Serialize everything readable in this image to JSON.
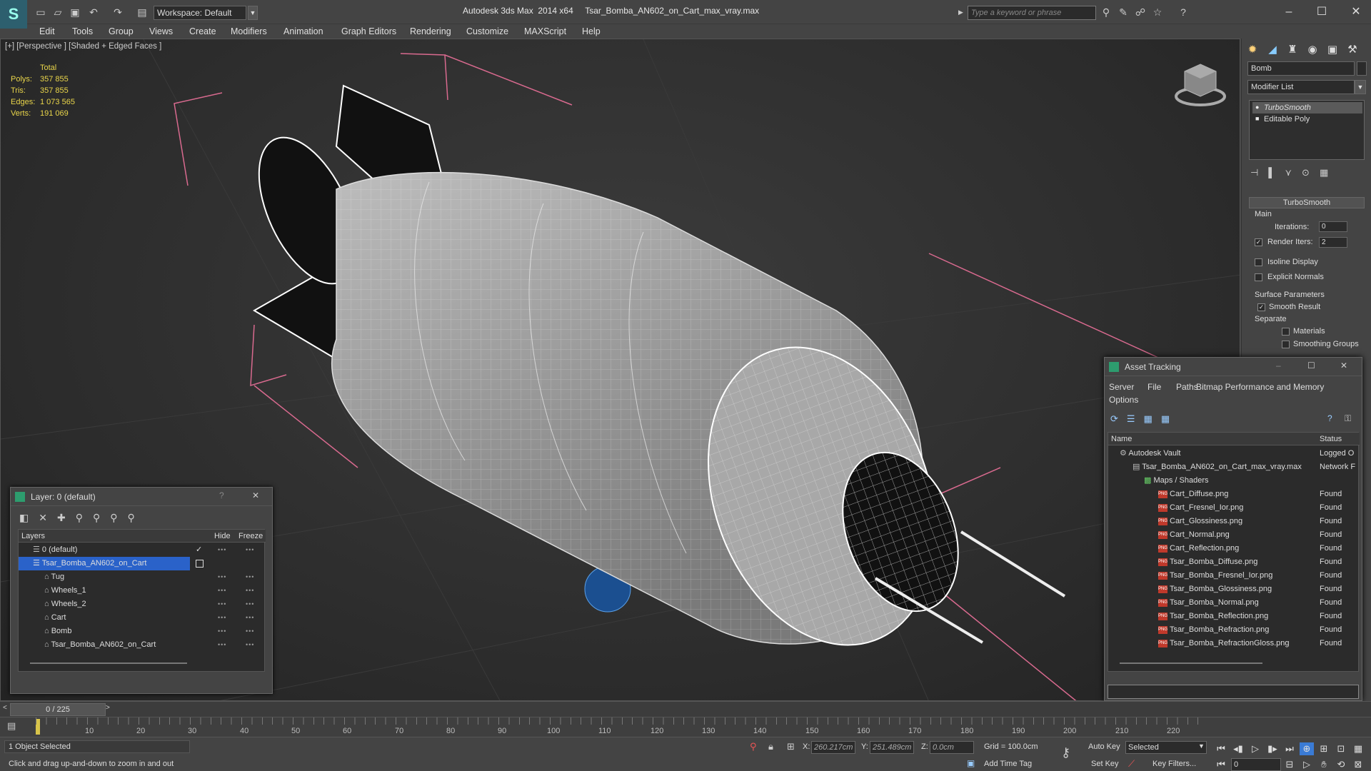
{
  "titlebar": {
    "workspace": "Workspace: Default",
    "title": "Autodesk 3ds Max  2014 x64     Tsar_Bomba_AN602_on_Cart_max_vray.max",
    "search_placeholder": "Type a keyword or phrase"
  },
  "menu": [
    "Edit",
    "Tools",
    "Group",
    "Views",
    "Create",
    "Modifiers",
    "Animation",
    "Graph Editors",
    "Rendering",
    "Customize",
    "MAXScript",
    "Help"
  ],
  "viewport": {
    "label": "[+] [Perspective ] [Shaded + Edged Faces ]",
    "stats": {
      "header": "Total",
      "rows": [
        {
          "label": "Polys:",
          "value": "357 855"
        },
        {
          "label": "Tris:",
          "value": "357 855"
        },
        {
          "label": "Edges:",
          "value": "1 073 565"
        },
        {
          "label": "Verts:",
          "value": "191 069"
        }
      ]
    }
  },
  "command_panel": {
    "object_name": "Bomb",
    "modifier_list": "Modifier List",
    "stack": [
      "TurboSmooth",
      "Editable Poly"
    ],
    "rollout_title": "TurboSmooth",
    "main_group": "Main",
    "iterations_label": "Iterations:",
    "iterations_value": "0",
    "render_iters_label": "Render Iters:",
    "render_iters_value": "2",
    "isoline_label": "Isoline Display",
    "explicit_label": "Explicit Normals",
    "surface_group": "Surface Parameters",
    "smooth_result_label": "Smooth Result",
    "separate_label": "Separate",
    "materials_label": "Materials",
    "smoothing_groups_label": "Smoothing Groups"
  },
  "layer_window": {
    "title": "Layer: 0 (default)",
    "col_layers": "Layers",
    "col_hide": "Hide",
    "col_freeze": "Freeze",
    "rows": [
      {
        "name": "0 (default)",
        "indent": 0
      },
      {
        "name": "Tsar_Bomba_AN602_on_Cart",
        "indent": 0
      },
      {
        "name": "Tug",
        "indent": 1
      },
      {
        "name": "Wheels_1",
        "indent": 1
      },
      {
        "name": "Wheels_2",
        "indent": 1
      },
      {
        "name": "Cart",
        "indent": 1
      },
      {
        "name": "Bomb",
        "indent": 1
      },
      {
        "name": "Tsar_Bomba_AN602_on_Cart",
        "indent": 1
      }
    ]
  },
  "asset_window": {
    "title": "Asset Tracking",
    "menu": [
      "Server",
      "File",
      "Paths",
      "Bitmap Performance and Memory"
    ],
    "menu2": "Options",
    "col_name": "Name",
    "col_status": "Status",
    "rows": [
      {
        "name": "Autodesk Vault",
        "status": "Logged O",
        "level": 0
      },
      {
        "name": "Tsar_Bomba_AN602_on_Cart_max_vray.max",
        "status": "Network F",
        "level": 1
      },
      {
        "name": "Maps / Shaders",
        "status": "",
        "level": 2
      },
      {
        "name": "Cart_Diffuse.png",
        "status": "Found",
        "level": 3
      },
      {
        "name": "Cart_Fresnel_Ior.png",
        "status": "Found",
        "level": 3
      },
      {
        "name": "Cart_Glossiness.png",
        "status": "Found",
        "level": 3
      },
      {
        "name": "Cart_Normal.png",
        "status": "Found",
        "level": 3
      },
      {
        "name": "Cart_Reflection.png",
        "status": "Found",
        "level": 3
      },
      {
        "name": "Tsar_Bomba_Diffuse.png",
        "status": "Found",
        "level": 3
      },
      {
        "name": "Tsar_Bomba_Fresnel_Ior.png",
        "status": "Found",
        "level": 3
      },
      {
        "name": "Tsar_Bomba_Glossiness.png",
        "status": "Found",
        "level": 3
      },
      {
        "name": "Tsar_Bomba_Normal.png",
        "status": "Found",
        "level": 3
      },
      {
        "name": "Tsar_Bomba_Reflection.png",
        "status": "Found",
        "level": 3
      },
      {
        "name": "Tsar_Bomba_Refraction.png",
        "status": "Found",
        "level": 3
      },
      {
        "name": "Tsar_Bomba_RefractionGloss.png",
        "status": "Found",
        "level": 3
      }
    ]
  },
  "timeline": {
    "frame": "0 / 225",
    "ticks": [
      "10",
      "20",
      "30",
      "40",
      "50",
      "60",
      "70",
      "80",
      "90",
      "100",
      "110",
      "120",
      "130",
      "140",
      "150",
      "160",
      "170",
      "180",
      "190",
      "200",
      "210",
      "220"
    ]
  },
  "status": {
    "selection": "1 Object Selected",
    "prompt": "Click and drag up-and-down to zoom in and out",
    "x_label": "X:",
    "x_value": "260.217cm",
    "y_label": "Y:",
    "y_value": "251.489cm",
    "z_label": "Z:",
    "z_value": "0.0cm",
    "grid": "Grid = 100.0cm",
    "add_time_tag": "Add Time Tag",
    "auto_key": "Auto Key",
    "set_key": "Set Key",
    "selected": "Selected",
    "key_filters": "Key Filters...",
    "current_frame": "0"
  }
}
